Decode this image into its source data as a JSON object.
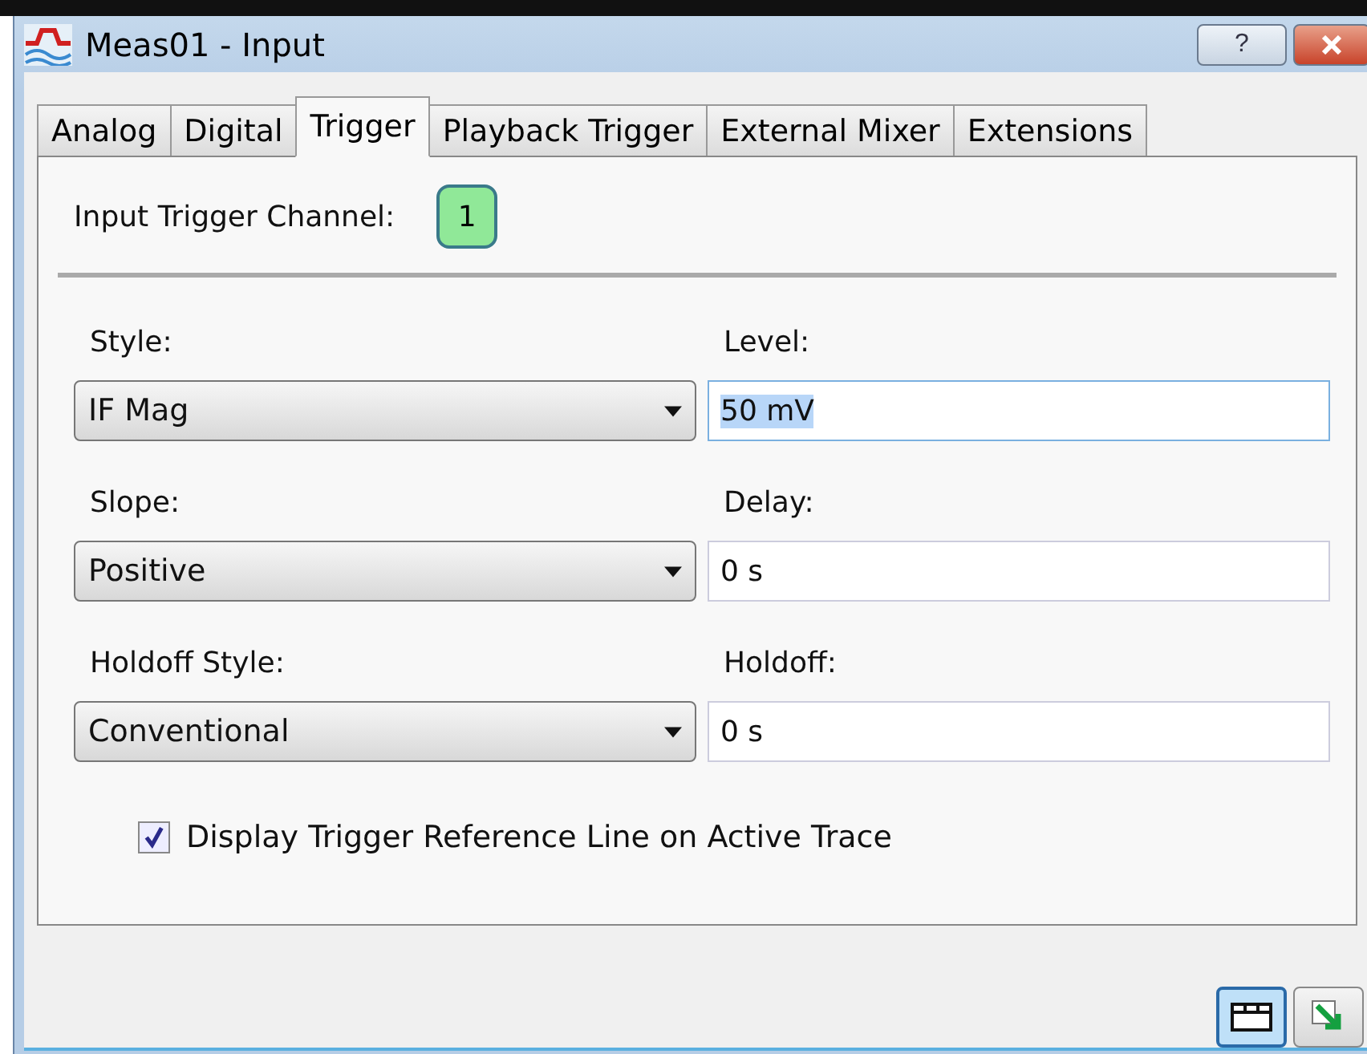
{
  "window": {
    "title": "Meas01 - Input",
    "help_button": "?"
  },
  "tabs": [
    {
      "label": "Analog",
      "selected": false
    },
    {
      "label": "Digital",
      "selected": false
    },
    {
      "label": "Trigger",
      "selected": true
    },
    {
      "label": "Playback Trigger",
      "selected": false
    },
    {
      "label": "External Mixer",
      "selected": false
    },
    {
      "label": "Extensions",
      "selected": false
    }
  ],
  "channel": {
    "label": "Input Trigger Channel:",
    "value": "1"
  },
  "rows": [
    {
      "left_label": "Style:",
      "dropdown": "IF Mag",
      "right_label": "Level:",
      "field": "50 mV",
      "focused": true
    },
    {
      "left_label": "Slope:",
      "dropdown": "Positive",
      "right_label": "Delay:",
      "field": "0 s",
      "focused": false
    },
    {
      "left_label": "Holdoff Style:",
      "dropdown": "Conventional",
      "right_label": "Holdoff:",
      "field": "0 s",
      "focused": false
    }
  ],
  "checkbox": {
    "label": "Display Trigger Reference Line on Active Trace",
    "checked": true
  },
  "footer_buttons": [
    {
      "kind": "window",
      "selected": true
    },
    {
      "kind": "export",
      "selected": false
    }
  ]
}
